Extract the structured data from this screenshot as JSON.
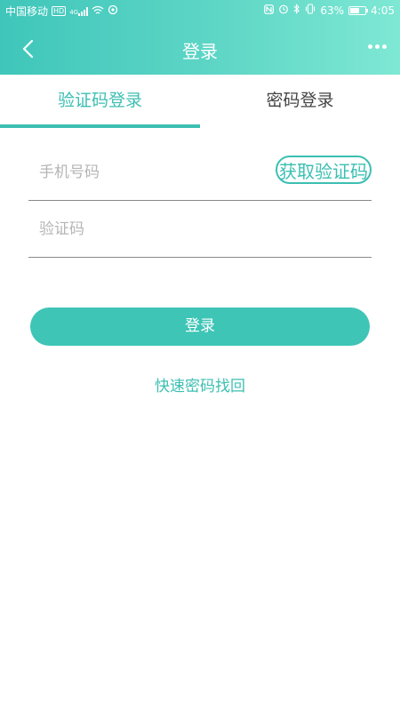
{
  "status_bar": {
    "carrier": "中国移动",
    "hd_badge": "HD",
    "network": "4G",
    "battery_text": "63%",
    "battery_level": 0.63,
    "time": "4:05"
  },
  "header": {
    "title": "登录"
  },
  "tabs": [
    {
      "label": "验证码登录",
      "active": true
    },
    {
      "label": "密码登录",
      "active": false
    }
  ],
  "form": {
    "phone": {
      "placeholder": "手机号码",
      "value": ""
    },
    "code": {
      "placeholder": "验证码",
      "value": ""
    },
    "get_code_label": "获取验证码",
    "submit_label": "登录",
    "recover_label": "快速密码找回"
  },
  "colors": {
    "accent": "#3cbfb2",
    "header_gradient_start": "#3fc6ba",
    "header_gradient_end": "#7ee8d4"
  },
  "icons": {
    "back": "chevron-left-icon",
    "more": "more-dots-icon",
    "nfc": "nfc-icon",
    "alarm": "alarm-icon",
    "bluetooth": "bluetooth-icon",
    "vibrate": "vibrate-icon",
    "wifi": "wifi-icon",
    "signal": "signal-bars-icon",
    "battery": "battery-icon"
  }
}
